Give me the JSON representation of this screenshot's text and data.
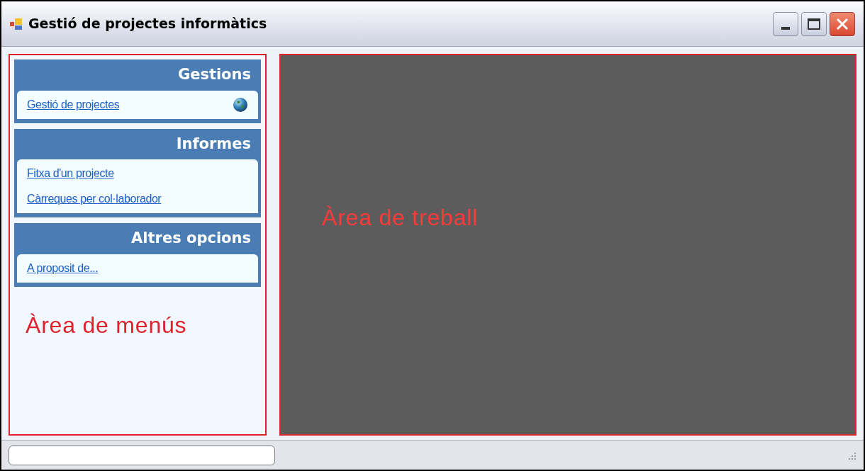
{
  "window": {
    "title": "Gestió de projectes informàtics"
  },
  "menu_groups": [
    {
      "title": "Gestions",
      "items": [
        {
          "label": "Gestió de projectes",
          "kind": "globe"
        }
      ]
    },
    {
      "title": "Informes",
      "items": [
        {
          "label": "Fitxa d'un projecte",
          "kind": "plain"
        },
        {
          "label": "Càrreques per col·laborador",
          "kind": "plain"
        }
      ]
    },
    {
      "title": "Altres opcions",
      "items": [
        {
          "label": "A proposit de...",
          "kind": "plain"
        }
      ]
    }
  ],
  "menu_area_label": "Àrea de menús",
  "work_area_label": "Àrea de treball"
}
